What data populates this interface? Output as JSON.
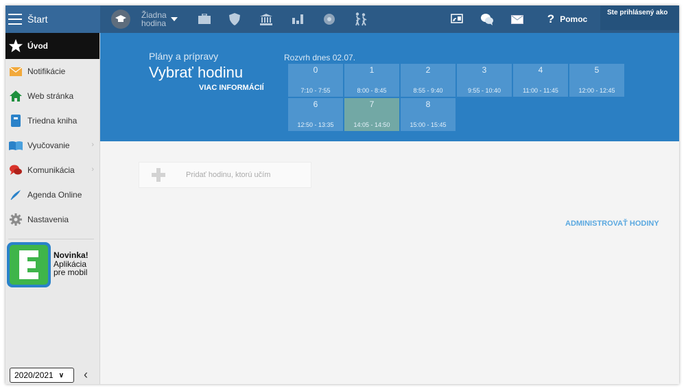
{
  "topbar": {
    "start_label": "Štart",
    "lesson_selector_line1": "Žiadna",
    "lesson_selector_line2": "hodina",
    "help_label": "Pomoc",
    "user_label": "Ste prihlásený ako"
  },
  "sidebar": {
    "items": [
      {
        "label": "Úvod",
        "icon": "star-icon"
      },
      {
        "label": "Notifikácie",
        "icon": "envelope-icon"
      },
      {
        "label": "Web stránka",
        "icon": "home-icon"
      },
      {
        "label": "Triedna kniha",
        "icon": "book-icon"
      },
      {
        "label": "Vyučovanie",
        "icon": "open-book-icon"
      },
      {
        "label": "Komunikácia",
        "icon": "chat-icon"
      },
      {
        "label": "Agenda Online",
        "icon": "pen-icon"
      },
      {
        "label": "Nastavenia",
        "icon": "gear-icon"
      }
    ],
    "promo_title": "Novinka!",
    "promo_line1": "Aplikácia",
    "promo_line2": "pre mobil",
    "year_value": "2020/2021"
  },
  "header": {
    "subtitle": "Plány a prípravy",
    "title": "Vybrať hodinu",
    "more_link": "VIAC INFORMÁCIÍ",
    "schedule_label": "Rozvrh dnes 02.07.",
    "slots": [
      {
        "num": "0",
        "time": "7:10 - 7:55"
      },
      {
        "num": "1",
        "time": "8:00 - 8:45"
      },
      {
        "num": "2",
        "time": "8:55 - 9:40"
      },
      {
        "num": "3",
        "time": "9:55 - 10:40"
      },
      {
        "num": "4",
        "time": "11:00 - 11:45"
      },
      {
        "num": "5",
        "time": "12:00 - 12:45"
      },
      {
        "num": "6",
        "time": "12:50 - 13:35"
      },
      {
        "num": "7",
        "time": "14:05 - 14:50"
      },
      {
        "num": "8",
        "time": "15:00 - 15:45"
      }
    ],
    "current_slot": "7"
  },
  "main": {
    "add_lesson_label": "Pridať hodinu, ktorú učím",
    "admin_link": "ADMINISTROVAŤ HODINY"
  },
  "colors": {
    "topbar": "#2c5a86",
    "header": "#2b7fc3",
    "slot": "#4e95cf",
    "current_slot": "#72a8a5",
    "link": "#5aa8e0"
  }
}
